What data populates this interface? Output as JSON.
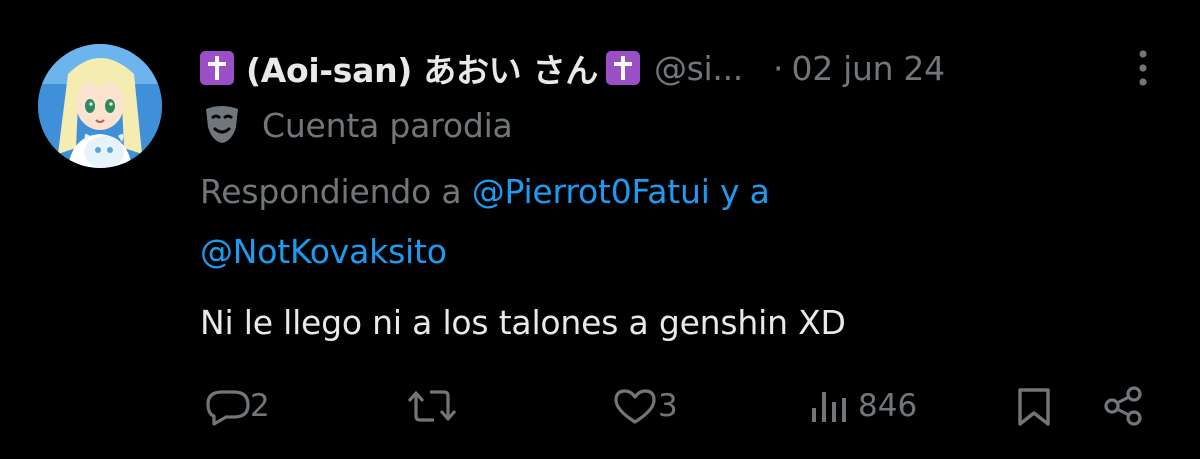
{
  "author": {
    "display_name": "(Aoi-san) あおい さん",
    "handle": "@si...",
    "separator": "·",
    "timestamp": "02 jun 24",
    "parody_label": "Cuenta parodia",
    "badge_icon": "latin-cross-emoji",
    "badge_color": "#9b4fc7"
  },
  "reply": {
    "prefix": "Respondiendo a",
    "mention_1": "@Pierrot0Fatui",
    "connector": "y a",
    "mention_2": "@NotKovaksito"
  },
  "body": {
    "text": "Ni le llego ni a los talones a genshin XD"
  },
  "actions": {
    "replies": "2",
    "reposts": "",
    "likes": "3",
    "views": "846"
  },
  "colors": {
    "background": "#000000",
    "primary_text": "#e7e9ea",
    "secondary_text": "#71767b",
    "link": "#1d9bf0"
  }
}
